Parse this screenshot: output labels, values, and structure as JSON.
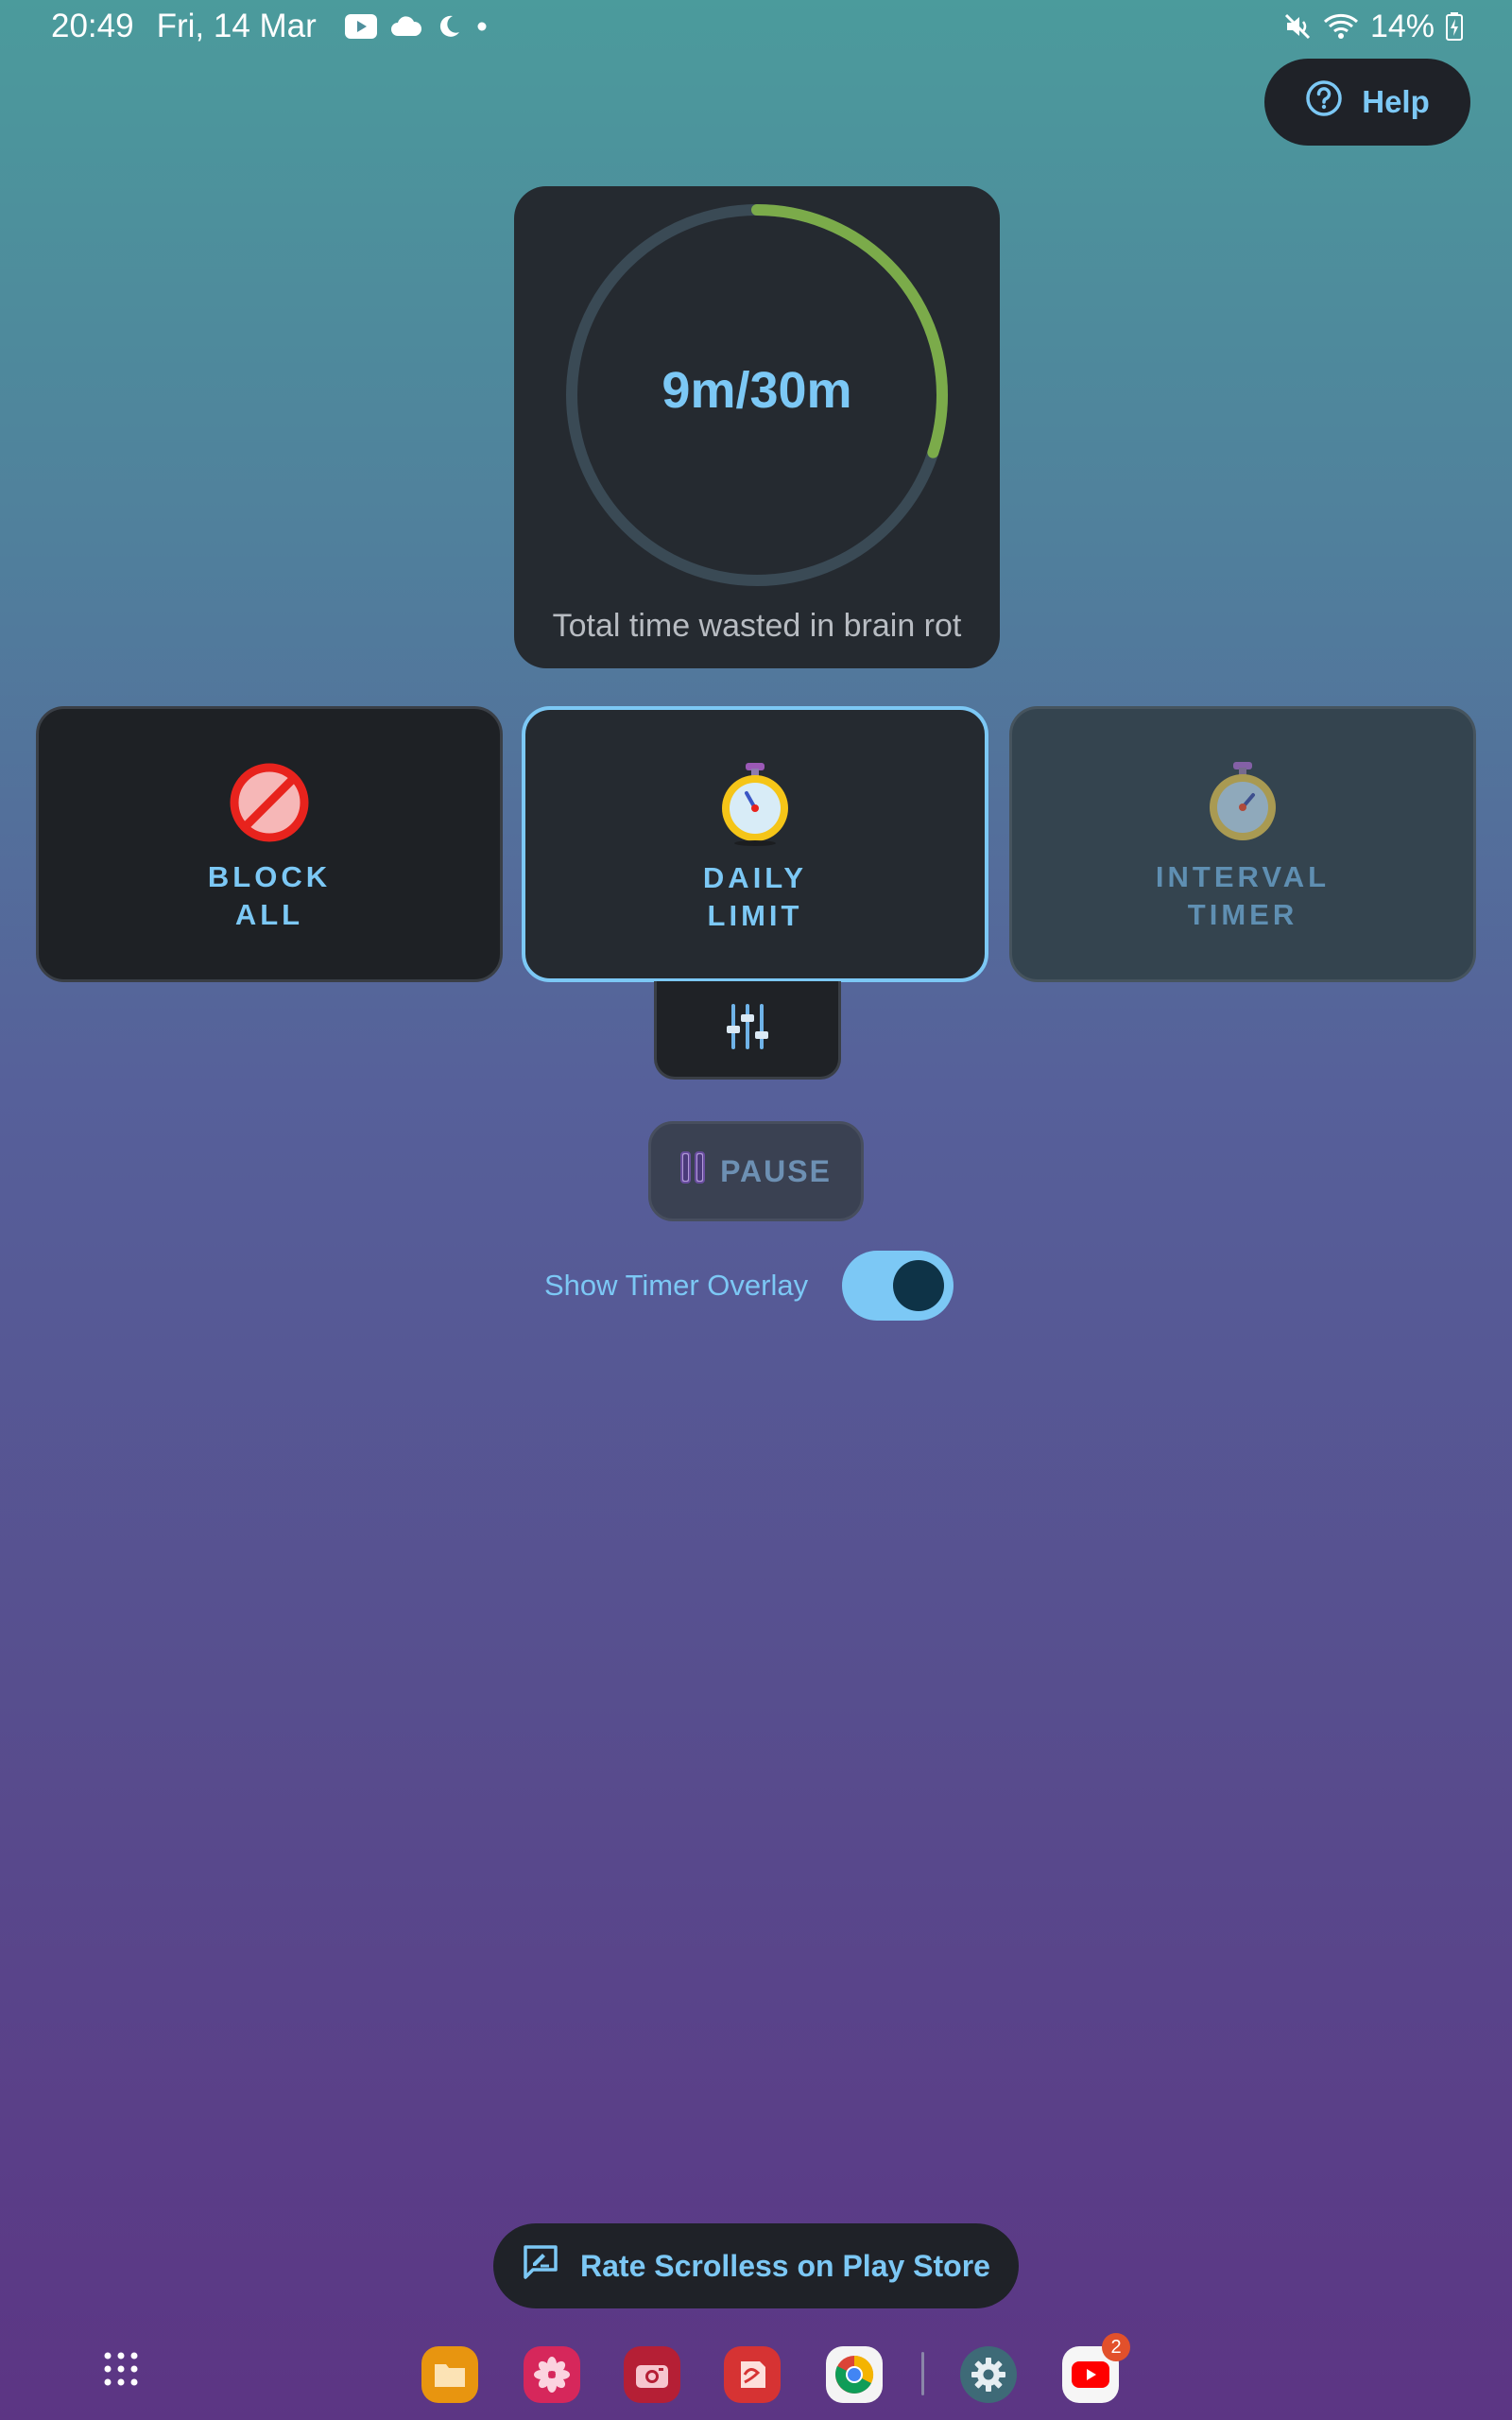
{
  "status_bar": {
    "time": "20:49",
    "date": "Fri, 14 Mar",
    "left_icons": [
      "youtube-icon",
      "cloud-icon",
      "moon-icon",
      "dot-icon"
    ],
    "right_icons": [
      "mute-icon",
      "wifi-icon"
    ],
    "battery": "14%"
  },
  "help": {
    "label": "Help",
    "icon": "help-circle-icon"
  },
  "progress": {
    "value_text": "9m/30m",
    "used_minutes": 9,
    "limit_minutes": 30,
    "fraction": 0.3,
    "caption": "Total time wasted in brain rot",
    "ring_color": "#7bab4a",
    "track_color": "#3a4a55"
  },
  "modes": [
    {
      "label": "BLOCK\nALL",
      "icon": "prohibited-icon",
      "selected": false
    },
    {
      "label": "DAILY\nLIMIT",
      "icon": "stopwatch-icon",
      "selected": true
    },
    {
      "label": "INTERVAL\nTIMER",
      "icon": "stopwatch-icon",
      "selected": false
    }
  ],
  "settings_tab": {
    "icon": "sliders-icon"
  },
  "pause": {
    "label": "PAUSE",
    "icon": "pause-icon"
  },
  "overlay": {
    "label": "Show Timer Overlay",
    "enabled": true
  },
  "rate": {
    "label": "Rate Scrolless on Play Store",
    "icon": "feedback-icon"
  },
  "dock": {
    "apps": [
      "app-drawer-icon",
      "files-icon",
      "gallery-icon",
      "camera-icon",
      "notes-icon",
      "chrome-icon",
      "settings-icon",
      "youtube-icon"
    ],
    "youtube_badge": "2"
  },
  "colors": {
    "accent": "#7cc8f5",
    "card": "#252a30",
    "selected_border": "#7cc8f5"
  }
}
